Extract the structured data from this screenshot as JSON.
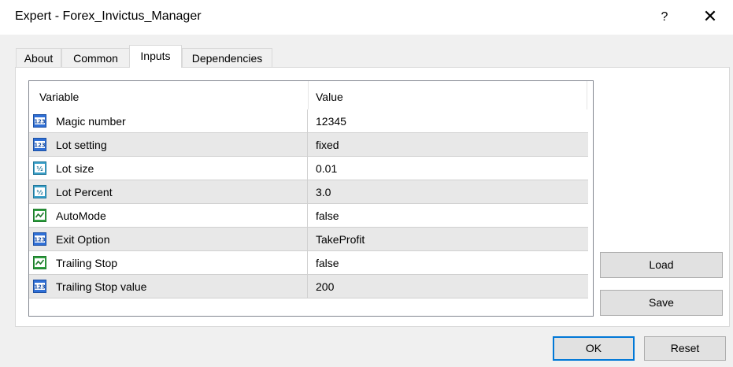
{
  "window": {
    "title": "Expert - Forex_Invictus_Manager",
    "help_label": "?",
    "close_label": "✕"
  },
  "tabs": [
    {
      "label": "About",
      "active": false
    },
    {
      "label": "Common",
      "active": false
    },
    {
      "label": "Inputs",
      "active": true
    },
    {
      "label": "Dependencies",
      "active": false
    }
  ],
  "grid": {
    "columns": [
      "Variable",
      "Value"
    ],
    "rows": [
      {
        "name": "Magic number",
        "value": "12345",
        "icon": "integer-icon"
      },
      {
        "name": "Lot setting",
        "value": "fixed",
        "icon": "integer-icon"
      },
      {
        "name": "Lot size",
        "value": "0.01",
        "icon": "double-icon"
      },
      {
        "name": "Lot Percent",
        "value": "3.0",
        "icon": "double-icon"
      },
      {
        "name": "AutoMode",
        "value": "false",
        "icon": "bool-icon"
      },
      {
        "name": "Exit Option",
        "value": "TakeProfit",
        "icon": "integer-icon"
      },
      {
        "name": "Trailing Stop",
        "value": "false",
        "icon": "bool-icon"
      },
      {
        "name": "Trailing Stop value",
        "value": "200",
        "icon": "integer-icon"
      }
    ]
  },
  "buttons": {
    "load": "Load",
    "save": "Save",
    "ok": "OK",
    "reset": "Reset"
  },
  "colors": {
    "accent": "#0078d7",
    "row_alt": "#e8e8e8",
    "dialog_bg": "#f0f0f0"
  }
}
